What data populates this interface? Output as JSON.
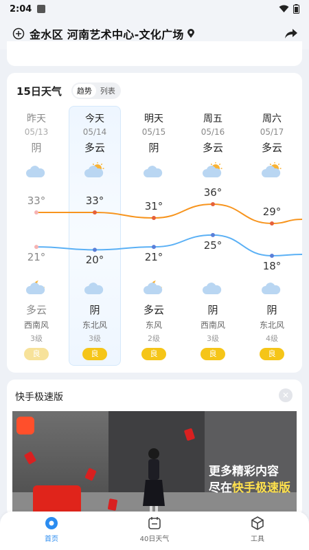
{
  "status_bar": {
    "time": "2:04"
  },
  "location": {
    "name": "金水区 河南艺术中心-文化广场"
  },
  "forecast": {
    "title": "15日天气",
    "view_toggle": [
      "趋势",
      "列表"
    ],
    "days": [
      {
        "name": "昨天",
        "date": "05/13",
        "day_condition": "阴",
        "day_icon": "overcast-cloud-icon",
        "high": "33°",
        "low": "21°",
        "night_icon": "partly-cloudy-moon-icon",
        "night_condition": "多云",
        "wind_dir": "西南风",
        "wind_level": "3级",
        "air_quality": "良",
        "past": true
      },
      {
        "name": "今天",
        "date": "05/14",
        "day_condition": "多云",
        "day_icon": "partly-cloudy-sun-icon",
        "high": "33°",
        "low": "20°",
        "night_icon": "overcast-cloud-icon",
        "night_condition": "阴",
        "wind_dir": "东北风",
        "wind_level": "3级",
        "air_quality": "良",
        "past": false
      },
      {
        "name": "明天",
        "date": "05/15",
        "day_condition": "阴",
        "day_icon": "overcast-cloud-icon",
        "high": "31°",
        "low": "21°",
        "night_icon": "partly-cloudy-moon-icon",
        "night_condition": "多云",
        "wind_dir": "东风",
        "wind_level": "2级",
        "air_quality": "良",
        "past": false
      },
      {
        "name": "周五",
        "date": "05/16",
        "day_condition": "多云",
        "day_icon": "partly-cloudy-sun-icon",
        "high": "36°",
        "low": "25°",
        "night_icon": "overcast-cloud-icon",
        "night_condition": "阴",
        "wind_dir": "西南风",
        "wind_level": "3级",
        "air_quality": "良",
        "past": false
      },
      {
        "name": "周六",
        "date": "05/17",
        "day_condition": "多云",
        "day_icon": "partly-cloudy-sun-icon",
        "high": "29°",
        "low": "18°",
        "night_icon": "overcast-cloud-icon",
        "night_condition": "阴",
        "wind_dir": "东北风",
        "wind_level": "4级",
        "air_quality": "良",
        "past": false
      }
    ],
    "colors": {
      "high_line": "#f7941d",
      "low_line": "#5ab0f5",
      "air_good": "#f5c518"
    }
  },
  "ad": {
    "title": "快手极速版",
    "promo_line1": "更多精彩内容",
    "promo_line2_prefix": "尽在",
    "promo_line2_highlight": "快手极速版"
  },
  "tabs": [
    {
      "label": "首页",
      "icon": "home-icon",
      "active": true
    },
    {
      "label": "40日天气",
      "icon": "calendar-icon",
      "active": false
    },
    {
      "label": "工具",
      "icon": "toolbox-icon",
      "active": false
    }
  ],
  "accent_color": "#2b8cf0"
}
